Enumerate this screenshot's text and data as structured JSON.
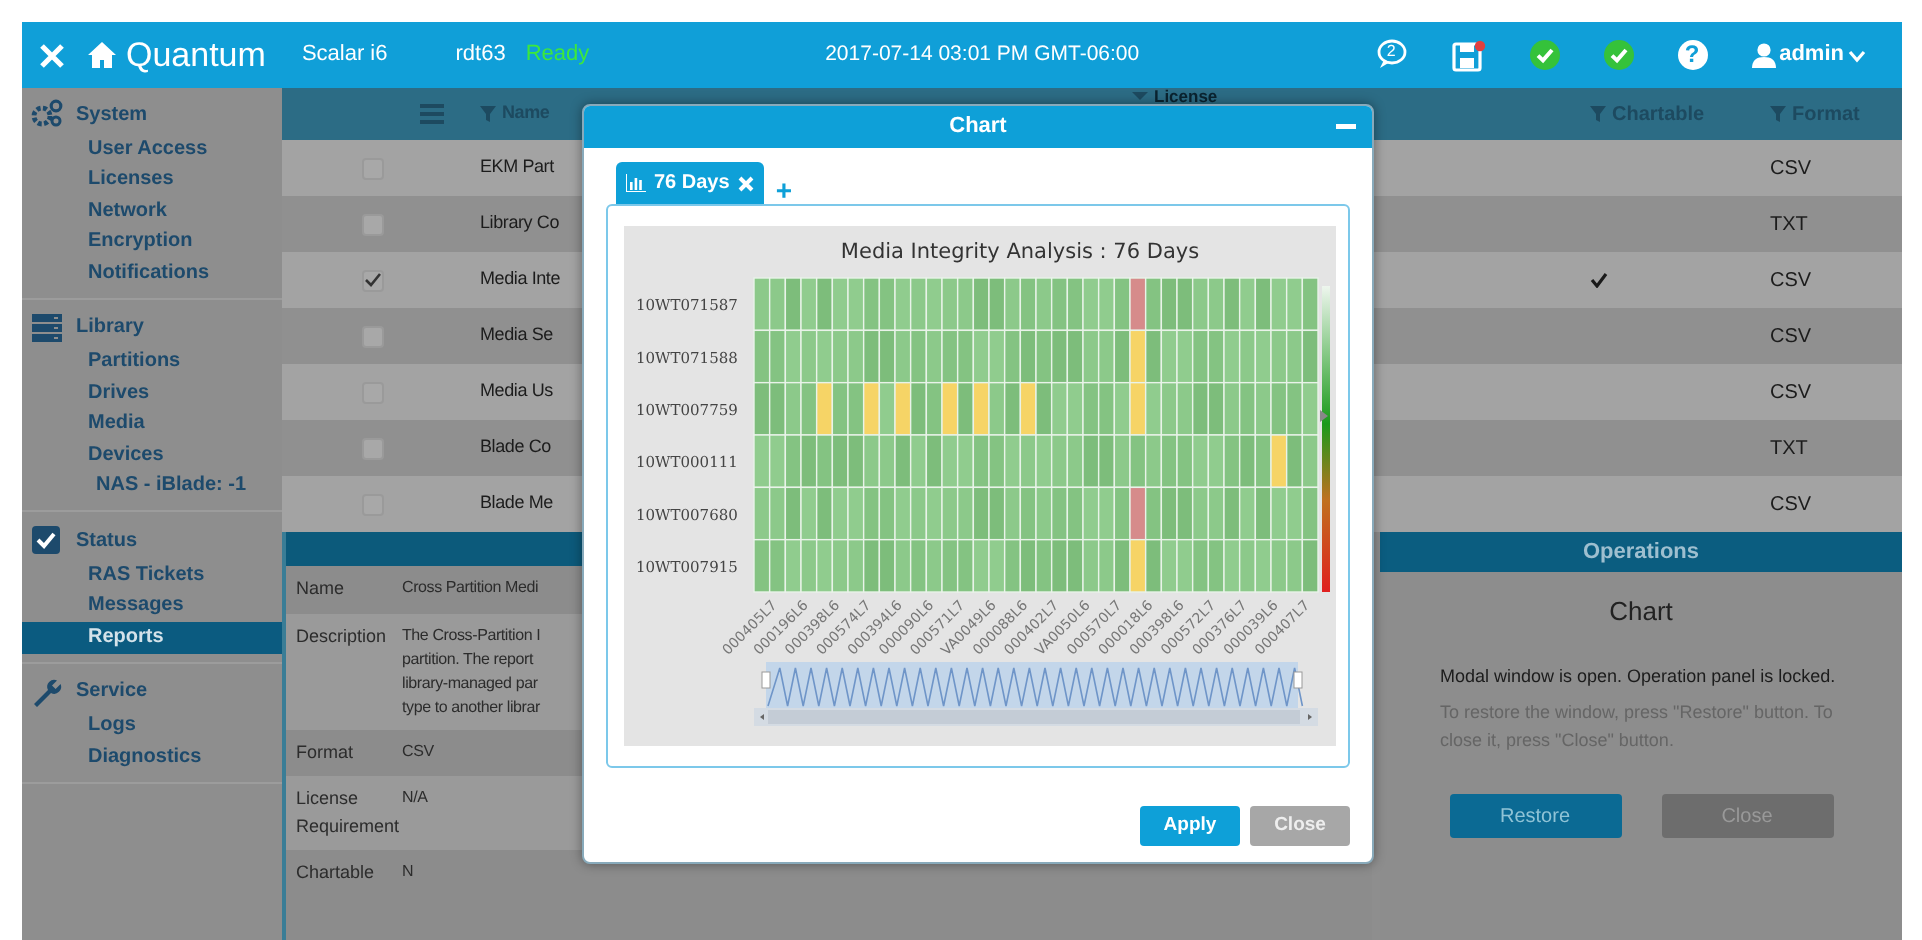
{
  "top_bar": {
    "product": "Quantum",
    "model": "Scalar i6",
    "host": "rdt63",
    "status": "Ready",
    "datetime": "2017-07-14 03:01 PM GMT-06:00",
    "icons": [
      {
        "kind": "chat",
        "badge": "2"
      },
      {
        "kind": "save"
      },
      {
        "kind": "check"
      },
      {
        "kind": "check"
      },
      {
        "kind": "help",
        "glyph": "?"
      }
    ],
    "user": "admin"
  },
  "sidebar": {
    "sections": [
      {
        "kind": "system",
        "label": "System",
        "items": [
          {
            "label": "User Access",
            "selected": false
          },
          {
            "label": "Licenses",
            "selected": false
          },
          {
            "label": "Network",
            "selected": false
          },
          {
            "label": "Encryption",
            "selected": false
          },
          {
            "label": "Notifications",
            "selected": false
          }
        ]
      },
      {
        "kind": "library",
        "label": "Library",
        "items": [
          {
            "label": "Partitions",
            "selected": false
          },
          {
            "label": "Drives",
            "selected": false
          },
          {
            "label": "Media",
            "selected": false
          },
          {
            "label": "Devices",
            "selected": false,
            "children": [
              {
                "label": "NAS - iBlade: -1",
                "selected": false
              }
            ]
          }
        ]
      },
      {
        "kind": "status",
        "label": "Status",
        "items": [
          {
            "label": "RAS Tickets",
            "selected": false
          },
          {
            "label": "Messages",
            "selected": false
          },
          {
            "label": "Reports",
            "selected": true
          }
        ]
      },
      {
        "kind": "service",
        "label": "Service",
        "items": [
          {
            "label": "Logs",
            "selected": false
          },
          {
            "label": "Diagnostics",
            "selected": false
          }
        ]
      }
    ]
  },
  "table": {
    "columns": [
      {
        "label": "Name",
        "kind": "filter"
      },
      {
        "label": "License",
        "kind": "sort"
      },
      {
        "label": "Chartable",
        "kind": "filter"
      },
      {
        "label": "Format",
        "kind": "filter"
      }
    ],
    "rows": [
      {
        "checked": false,
        "name": "EKM Part",
        "chartable": false,
        "format": "CSV"
      },
      {
        "checked": false,
        "name": "Library Co",
        "chartable": false,
        "format": "TXT"
      },
      {
        "checked": true,
        "name": "Media Inte",
        "chartable": true,
        "format": "CSV"
      },
      {
        "checked": false,
        "name": "Media Se",
        "chartable": false,
        "format": "CSV"
      },
      {
        "checked": false,
        "name": "Media Us",
        "chartable": false,
        "format": "CSV"
      },
      {
        "checked": false,
        "name": "Blade Co",
        "chartable": false,
        "format": "TXT"
      },
      {
        "checked": false,
        "name": "Blade Me",
        "chartable": false,
        "format": "CSV"
      }
    ]
  },
  "details": {
    "fields": [
      {
        "label": "Name",
        "value": "Cross Partition Medi"
      },
      {
        "label": "Description",
        "lines": [
          "The Cross-Partition I",
          "partition. The report",
          "library-managed par",
          "type to another librar"
        ]
      },
      {
        "label": "Format",
        "value": "CSV"
      },
      {
        "label": "License Requirement",
        "value": "N/A"
      },
      {
        "label": "Chartable",
        "value": "N"
      }
    ]
  },
  "operations": {
    "title": "Operations",
    "subtitle": "Chart",
    "notice": "Modal window is open. Operation panel is locked.",
    "hint": "To restore the window, press \"Restore\" button. To close it, press \"Close\" button.",
    "buttons": [
      {
        "label": "Restore",
        "kind": "primary"
      },
      {
        "label": "Close",
        "kind": "secondary"
      }
    ]
  },
  "modal": {
    "title": "Chart",
    "tabs": [
      {
        "label": "76 Days",
        "selected": true
      }
    ],
    "add_tab": "+",
    "chart": {
      "title": "Media Integrity Analysis : 76 Days",
      "row_labels": [
        "10WT071587",
        "10WT071588",
        "10WT007759",
        "10WT000111",
        "10WT007680",
        "10WT007915"
      ],
      "column_labels": [
        "000405L7",
        "000196L6",
        "000398L6",
        "000574L7",
        "000394L6",
        "000090L6",
        "000571L7",
        "VA0049L6",
        "000088L6",
        "000402L7",
        "VA0050L6",
        "000570L7",
        "000018L6",
        "000398L6",
        "000572L7",
        "000376L7",
        "000039L6",
        "000407L7"
      ]
    },
    "buttons": [
      {
        "label": "Apply",
        "kind": "primary"
      },
      {
        "label": "Close",
        "kind": "secondary"
      }
    ]
  }
}
